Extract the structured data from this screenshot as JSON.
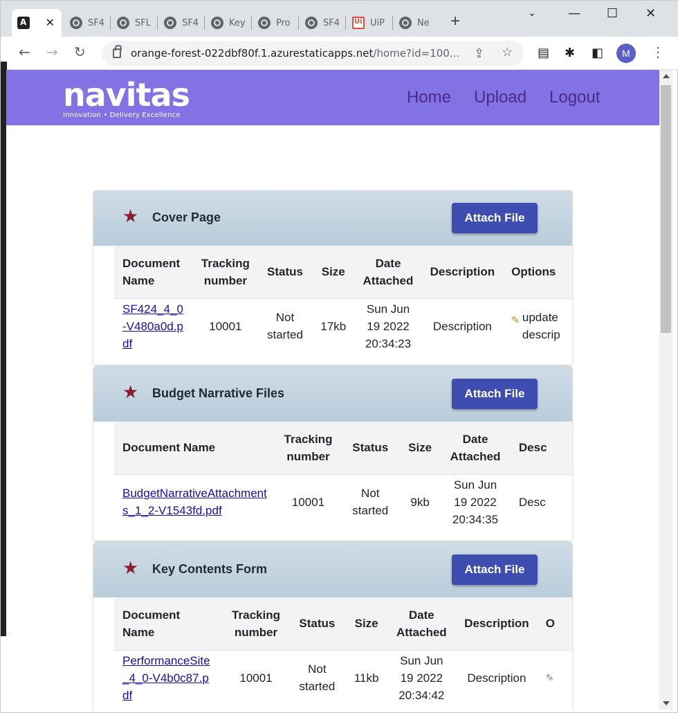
{
  "browser": {
    "tabs": [
      {
        "label": "",
        "icon": "angular-icon",
        "active": true
      },
      {
        "label": "SF4"
      },
      {
        "label": "SFL"
      },
      {
        "label": "SF4"
      },
      {
        "label": "Key"
      },
      {
        "label": "Pro"
      },
      {
        "label": "SF4"
      },
      {
        "label": "UiP"
      },
      {
        "label": "Ne"
      }
    ],
    "new_tab": "+",
    "url_host": "orange-forest-022dbf80f.1.azurestaticapps.net",
    "url_path": "/home?id=100...",
    "avatar_initial": "M",
    "window_controls": {
      "minimize": "—",
      "maximize": "☐",
      "close": "✕"
    }
  },
  "site": {
    "logo_text": "navitas",
    "logo_tagline": "Innovation • Delivery Excellence",
    "nav": [
      "Home",
      "Upload",
      "Logout"
    ],
    "header_color": "#8272e3",
    "nav_color": "#4a2a8a"
  },
  "sections": [
    {
      "title": "Cover Page",
      "attach_label": "Attach File",
      "columns": [
        "Document Name",
        "Tracking number",
        "Status",
        "Size",
        "Date Attached",
        "Description",
        "Options"
      ],
      "row": {
        "document": "SF424_4_0-V480a0d.pdf",
        "tracking": "10001",
        "status": "Not started",
        "size": "17kb",
        "date": "Sun Jun 19 2022 20:34:23",
        "description": "Description",
        "option": "update descrip"
      }
    },
    {
      "title": "Budget Narrative Files",
      "attach_label": "Attach File",
      "columns": [
        "Document Name",
        "Tracking number",
        "Status",
        "Size",
        "Date Attached",
        "Desc"
      ],
      "row": {
        "document": "BudgetNarrativeAttachments_1_2-V1543fd.pdf",
        "tracking": "10001",
        "status": "Not started",
        "size": "9kb",
        "date": "Sun Jun 19 2022 20:34:35",
        "description": "Desc"
      }
    },
    {
      "title": "Key Contents Form",
      "attach_label": "Attach File",
      "columns": [
        "Document Name",
        "Tracking number",
        "Status",
        "Size",
        "Date Attached",
        "Description",
        "O"
      ],
      "row": {
        "document": "PerformanceSite_4_0-V4b0c87.pdf",
        "tracking": "10001",
        "status": "Not started",
        "size": "11kb",
        "date": "Sun Jun 19 2022 20:34:42",
        "description": "Description"
      }
    }
  ],
  "accent_button": "#3d4eb0",
  "star_color": "#8a1f2e"
}
